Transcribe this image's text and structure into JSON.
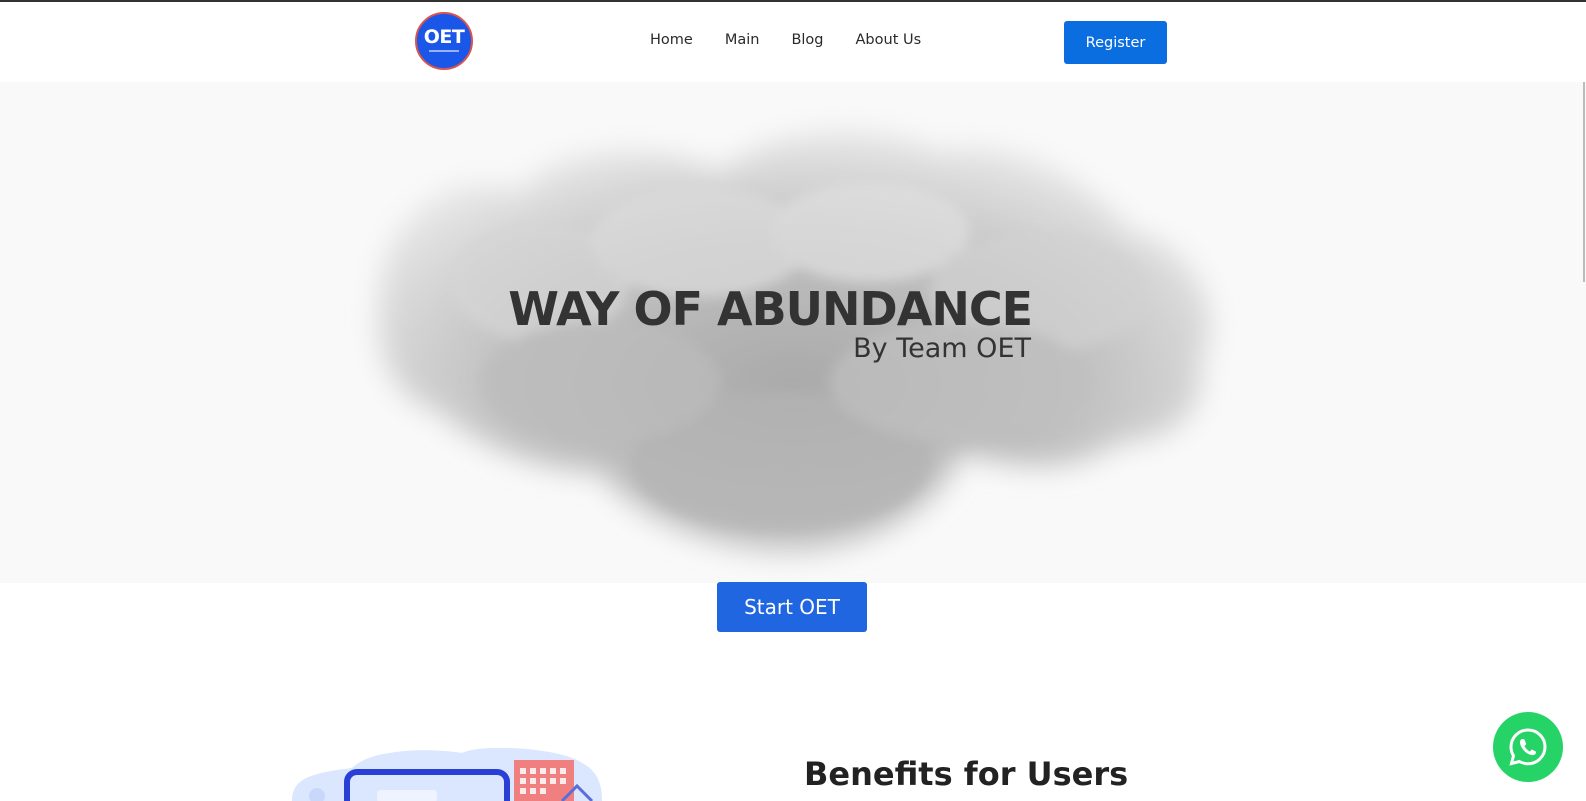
{
  "brand": {
    "logo_text": "OET"
  },
  "nav": {
    "items": [
      "Home",
      "Main",
      "Blog",
      "About Us"
    ],
    "register_label": "Register"
  },
  "hero": {
    "title": "WAY OF ABUNDANCE",
    "subtitle": "By Team OET",
    "cta_label": "Start OET"
  },
  "benefits": {
    "title": "Benefits for Users"
  },
  "icons": {
    "whatsapp": "whatsapp-icon"
  },
  "colors": {
    "primary": "#0b6ee0",
    "cta": "#1f66e0",
    "whatsapp": "#25d366",
    "logo": "#1a56e8"
  }
}
